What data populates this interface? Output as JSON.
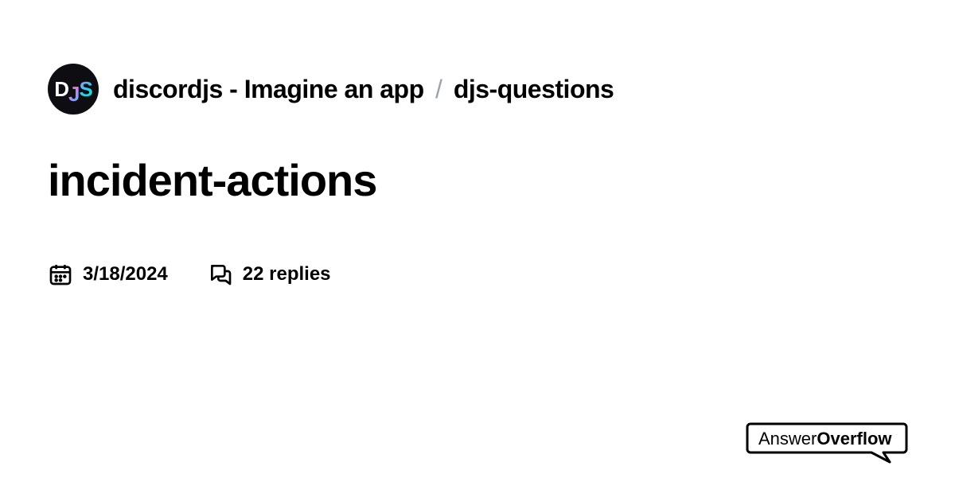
{
  "breadcrumb": {
    "server": "discordjs - Imagine an app",
    "channel": "djs-questions",
    "separator": "/"
  },
  "avatar": {
    "letters": [
      "D",
      "J",
      "S"
    ]
  },
  "title": "incident-actions",
  "meta": {
    "date": "3/18/2024",
    "replies": "22 replies"
  },
  "brand": {
    "part1": "Answer",
    "part2": "Overflow"
  }
}
